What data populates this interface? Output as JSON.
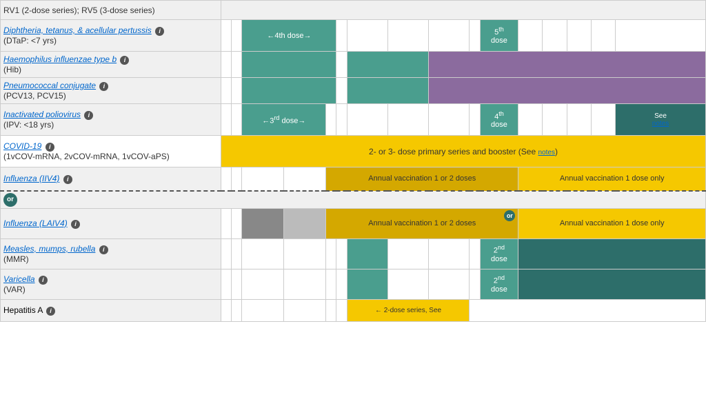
{
  "rows": [
    {
      "id": "rv",
      "name_html": "RV1 (2-dose series); RV5 (3-dose series)",
      "link": false,
      "subtitle": ""
    },
    {
      "id": "dtap",
      "name": "Diphtheria, tetanus, & acellular pertussis",
      "link": true,
      "subtitle": "(DTaP: <7 yrs)",
      "info": true
    },
    {
      "id": "hib",
      "name": "Haemophilus influenzae type b",
      "link": true,
      "subtitle": "(Hib)",
      "info": true
    },
    {
      "id": "pcv",
      "name": "Pneumococcal conjugate",
      "link": true,
      "subtitle": "(PCV13, PCV15)",
      "info": true
    },
    {
      "id": "ipv",
      "name": "Inactivated poliovirus",
      "link": true,
      "subtitle": "(IPV: <18 yrs)",
      "info": true
    },
    {
      "id": "covid",
      "name": "COVID-19",
      "link": true,
      "subtitle": "(1vCOV-mRNA, 2vCOV-mRNA, 1vCOV-aPS)",
      "info": true
    },
    {
      "id": "iiv4",
      "name": "Influenza (IIV4)",
      "link": true,
      "subtitle": "",
      "info": true
    },
    {
      "id": "laiv4_or",
      "name": "or",
      "is_or": true
    },
    {
      "id": "laiv4",
      "name": "Influenza (LAIV4)",
      "link": true,
      "subtitle": "",
      "info": true
    },
    {
      "id": "mmr",
      "name": "Measles, mumps, rubella",
      "link": true,
      "subtitle": "(MMR)",
      "info": true
    },
    {
      "id": "var",
      "name": "Varicella",
      "link": true,
      "subtitle": "(VAR)",
      "info": true
    },
    {
      "id": "hepa",
      "name": "Hepatitis A",
      "link": false,
      "subtitle": "",
      "info": true
    }
  ],
  "labels": {
    "dtap_4th": "←4th dose→",
    "dtap_5th_top": "5th",
    "dtap_5th_bot": "dose",
    "ipv_3rd": "←3rd dose→",
    "ipv_4th_top": "4th",
    "ipv_4th_bot": "dose",
    "ipv_see": "See",
    "ipv_notes": "notes",
    "covid_span": "2- or 3- dose primary series and booster (See notes)",
    "iiv4_annual1": "Annual vaccination 1 or 2 doses",
    "iiv4_annual2": "Annual vaccination 1 dose only",
    "laiv4_annual1": "Annual vaccination 1 or 2 doses",
    "laiv4_annual2": "Annual vaccination 1 dose only",
    "mmr_2nd_top": "2nd",
    "mmr_2nd_bot": "dose",
    "var_2nd_top": "2nd",
    "var_2nd_bot": "dose",
    "hepa_span": "← 2-dose series, See",
    "or_label": "or"
  },
  "colors": {
    "teal": "#4a9e8e",
    "teal_dark": "#2d6e6a",
    "purple": "#8b6b9e",
    "yellow": "#f5c800",
    "yellow_dark": "#d4a800",
    "gray": "#888888",
    "gray_light": "#bbbbbb"
  }
}
